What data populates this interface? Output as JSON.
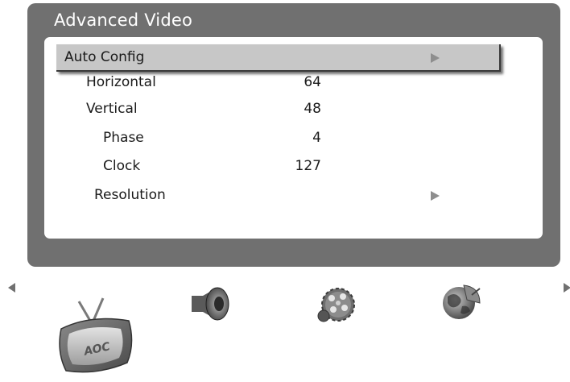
{
  "window": {
    "title": "Advanced Video"
  },
  "menu": {
    "items": [
      {
        "label": "Auto Config",
        "value": "",
        "has_submenu": true,
        "selected": true
      },
      {
        "label": "Horizontal",
        "value": "64",
        "has_submenu": false,
        "selected": false
      },
      {
        "label": "Vertical",
        "value": "48",
        "has_submenu": false,
        "selected": false
      },
      {
        "label": "Phase",
        "value": "4",
        "has_submenu": false,
        "selected": false
      },
      {
        "label": "Clock",
        "value": "127",
        "has_submenu": false,
        "selected": false
      },
      {
        "label": "Resolution",
        "value": "",
        "has_submenu": true,
        "selected": false
      }
    ]
  },
  "bottom_nav": {
    "icons": [
      "tv-aoc-icon",
      "speaker-icon",
      "gears-icon",
      "globe-satellite-icon"
    ],
    "tv_logo": "AOC",
    "active_icon": "tv-aoc-icon"
  },
  "colors": {
    "panel": "#707070",
    "selection": "#c7c7c7",
    "submenu_arrow": "#8e8e8e"
  }
}
